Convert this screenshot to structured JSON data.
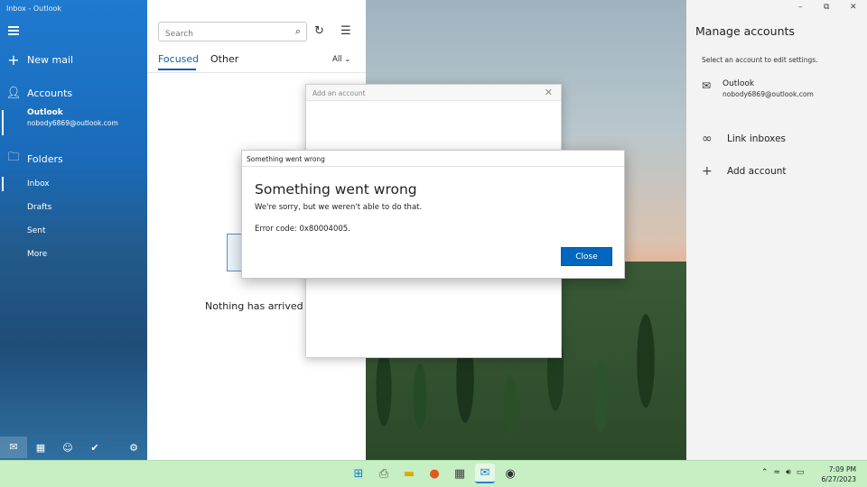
{
  "window": {
    "title": "Inbox - Outlook"
  },
  "nav": {
    "new_mail": "New mail",
    "accounts_label": "Accounts",
    "account": {
      "name": "Outlook",
      "email": "nobody6869@outlook.com"
    },
    "folders_label": "Folders",
    "folders": [
      "Inbox",
      "Drafts",
      "Sent",
      "More"
    ]
  },
  "list": {
    "search_placeholder": "Search",
    "tabs": [
      "Focused",
      "Other"
    ],
    "filter": "All",
    "empty_text": "Nothing has arrived ye"
  },
  "manage": {
    "title": "Manage accounts",
    "subtitle": "Select an account to edit settings.",
    "account": {
      "name": "Outlook",
      "email": "nobody6869@outlook.com"
    },
    "link_inboxes": "Link inboxes",
    "add_account": "Add account"
  },
  "add_dialog": {
    "title": "Add an account"
  },
  "error_dialog": {
    "header": "Something went wrong",
    "title": "Something went wrong",
    "message": "We're sorry, but we weren't able to do that.",
    "code": "Error code: 0x80004005.",
    "close_label": "Close"
  },
  "taskbar": {
    "time": "7:09 PM",
    "date": "6/27/2023",
    "apps": [
      "windows-start-icon",
      "printer-icon",
      "file-explorer-icon",
      "firefox-icon",
      "calculator-icon",
      "mail-icon",
      "camera-icon"
    ]
  },
  "colors": {
    "accent": "#0067c0",
    "nav": "#1f7ad0",
    "taskbar": "#c6efc4"
  }
}
